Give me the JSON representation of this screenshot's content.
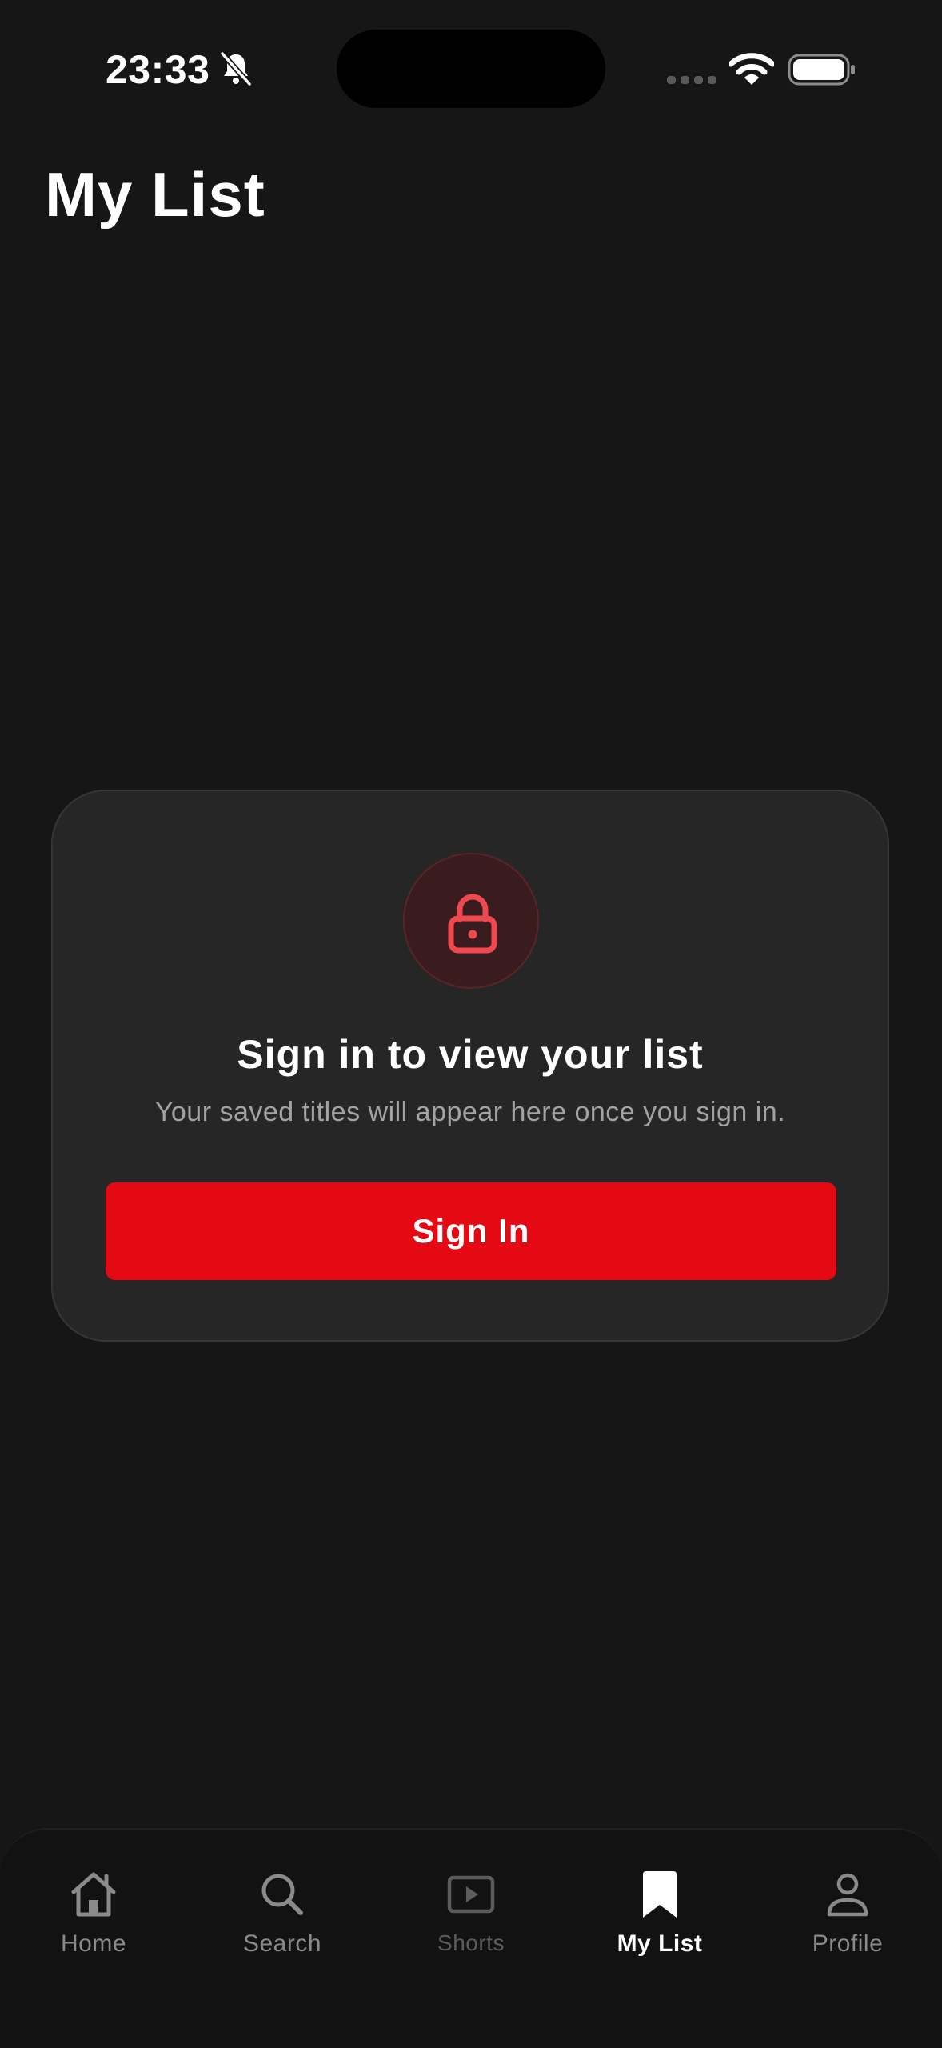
{
  "status_bar": {
    "time": "23:33",
    "icons": [
      "bell-slash-icon",
      "cellular-signal-icon",
      "wifi-icon",
      "battery-icon"
    ]
  },
  "page": {
    "title": "My List"
  },
  "card": {
    "icon": "lock-icon",
    "title": "Sign in to view your list",
    "subtitle": "Your saved titles will appear here once you sign in.",
    "button_label": "Sign In"
  },
  "tab_bar": {
    "items": [
      {
        "label": "Home",
        "icon": "home-icon",
        "active": false
      },
      {
        "label": "Search",
        "icon": "search-icon",
        "active": false
      },
      {
        "label": "Shorts",
        "icon": "play-square-icon",
        "active": false
      },
      {
        "label": "My List",
        "icon": "bookmark-icon",
        "active": true
      },
      {
        "label": "Profile",
        "icon": "person-icon",
        "active": false
      }
    ]
  },
  "colors": {
    "background": "#161616",
    "card": "#262626",
    "accent": "#e50914",
    "lock": "#f0484f",
    "inactive_tab": "#8a8a8a",
    "active_tab": "#ffffff"
  }
}
